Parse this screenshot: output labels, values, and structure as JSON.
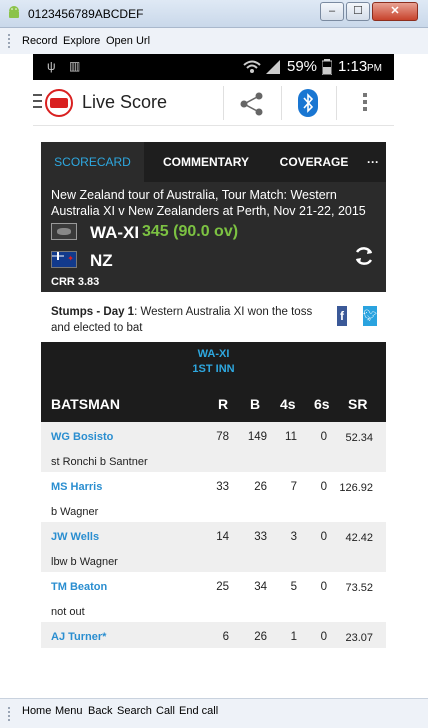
{
  "window": {
    "title": "0123456789ABCDEF",
    "buttons": {
      "minimize": "–",
      "maximize": "☐",
      "close": "✕"
    }
  },
  "menubar": {
    "items": [
      "Record",
      "Explore",
      "Open Url"
    ]
  },
  "bottombar": {
    "items": [
      "Home",
      "Menu",
      "Back",
      "Search",
      "Call",
      "End call"
    ]
  },
  "statusbar": {
    "battery": "59%",
    "time": "1:13",
    "ampm": "PM"
  },
  "actionbar": {
    "title": "Live Score"
  },
  "tabs": [
    {
      "label": "SCORECARD",
      "active": true
    },
    {
      "label": "COMMENTARY",
      "active": false
    },
    {
      "label": "COVERAGE",
      "active": false
    },
    {
      "label": "···",
      "active": false
    }
  ],
  "match": {
    "description": "New Zealand tour of Australia, Tour Match: Western Australia XI v New Zealanders at Perth, Nov 21-22, 2015",
    "team1": "WA-XI",
    "team1_score": "345 (90.0 ov)",
    "team2": "NZ",
    "crr": "CRR 3.83"
  },
  "status": {
    "label": "Stumps - Day 1",
    "text": ": Western Australia XI won the toss and elected to bat"
  },
  "innings": {
    "team": "WA-XI",
    "label": "1ST INN",
    "columns": {
      "batsman": "BATSMAN",
      "r": "R",
      "b": "B",
      "fours": "4s",
      "sixes": "6s",
      "sr": "SR"
    }
  },
  "batsmen": [
    {
      "name": "WG Bosisto",
      "dismissal": "st Ronchi b Santner",
      "r": "78",
      "b": "149",
      "fours": "11",
      "sixes": "0",
      "sr": "52.34"
    },
    {
      "name": "MS Harris",
      "dismissal": "b Wagner",
      "r": "33",
      "b": "26",
      "fours": "7",
      "sixes": "0",
      "sr": "126.92"
    },
    {
      "name": "JW Wells",
      "dismissal": "lbw b Wagner",
      "r": "14",
      "b": "33",
      "fours": "3",
      "sixes": "0",
      "sr": "42.42"
    },
    {
      "name": "TM Beaton",
      "dismissal": "not out",
      "r": "25",
      "b": "34",
      "fours": "5",
      "sixes": "0",
      "sr": "73.52"
    },
    {
      "name": "AJ Turner*",
      "dismissal": "",
      "r": "6",
      "b": "26",
      "fours": "1",
      "sixes": "0",
      "sr": "23.07"
    }
  ],
  "colors": {
    "accent": "#2ea8e0",
    "score_green": "#7cc242",
    "dark": "#2b2b2b"
  }
}
